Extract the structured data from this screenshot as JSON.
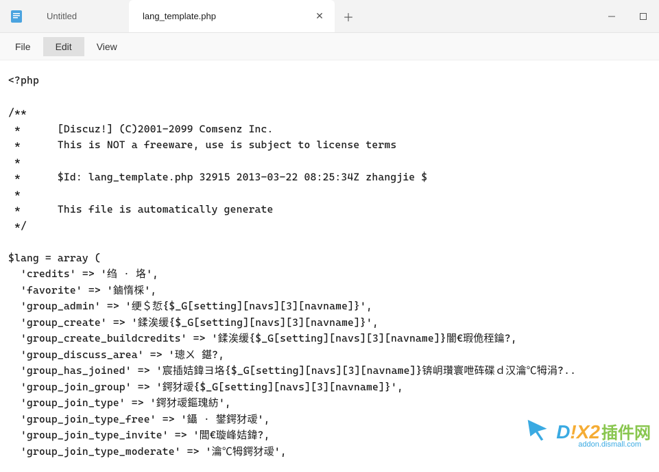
{
  "tabs": {
    "inactive": {
      "label": "Untitled"
    },
    "active": {
      "label": "lang_template.php"
    }
  },
  "menu": {
    "file": "File",
    "edit": "Edit",
    "view": "View"
  },
  "code_lines": [
    "<?php",
    "",
    "/**",
    " *      [Discuz!] (C)2001-2099 Comsenz Inc.",
    " *      This is NOT a freeware, use is subject to license terms",
    " *",
    " *      $Id: lang_template.php 32915 2013-03-22 08:25:34Z zhangjie $",
    " *",
    " *      This file is automatically generate",
    " */",
    "",
    "$lang = array (",
    "  'credits' => '绉 · 垎',",
    "  'favorite' => '鏀惰棌',",
    "  'group_admin' => '绠＄悊{$_G[setting][navs][3][navname]}',",
    "  'group_create' => '鍒涘缓{$_G[setting][navs][3][navname]}',",
    "  'group_create_buildcredits' => '鍒涘缓{$_G[setting][navs][3][navname]}闇€瑕佹秷鑰?,",
    "  'group_discuss_area' => '璁ㄨ 鍖?,",
    "  'group_has_joined' => '宸插姞鍏ヨ垎{$_G[setting][navs][3][navname]}锛岄瓚寰呭砗碟ｄ汉瀹℃牳涓?..",
    "  'group_join_group' => '鍔犲叆{$_G[setting][navs][3][navname]}',",
    "  'group_join_type' => '鍔犲叆鏂瑰紡',",
    "  'group_join_type_free' => '鑷 · 鐢鍔犲叆',",
    "  'group_join_type_invite' => '閭€璇峰姞鍏?,",
    "  'group_join_type_moderate' => '瀹℃牳鍔犲叆',"
  ],
  "watermark": {
    "logo_d": "D",
    "logo_x": "!X2",
    "logo_cn": "插件网",
    "url": "addon.dismall.com"
  }
}
